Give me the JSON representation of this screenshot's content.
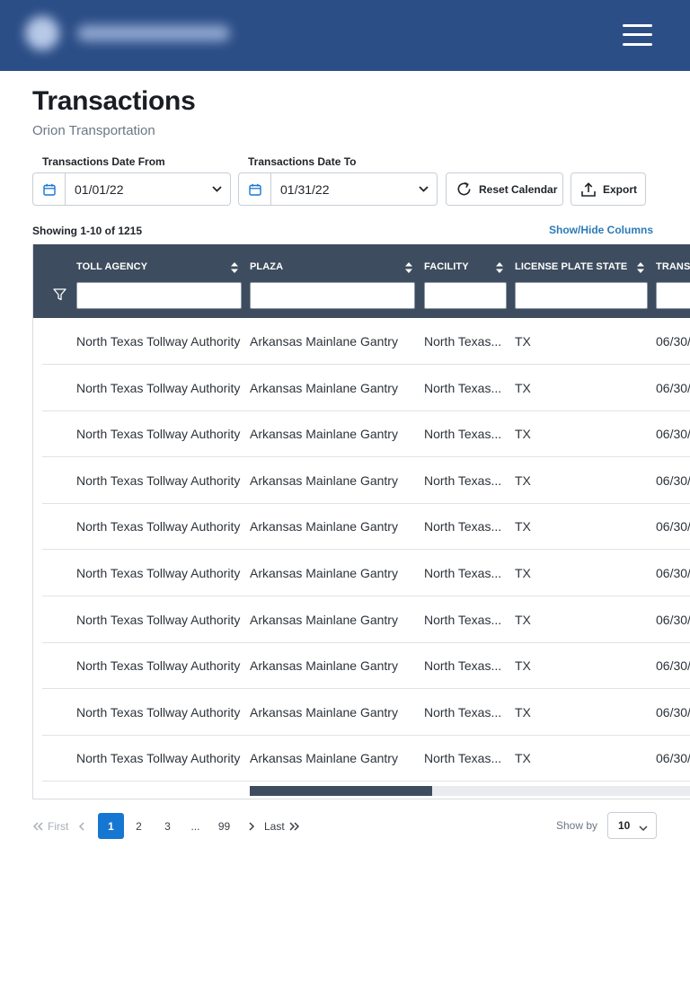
{
  "header": {
    "brand_logo_alt": "company logo (blurred)",
    "menu_icon": "hamburger-menu-icon",
    "background_color": "#2c4e87"
  },
  "page": {
    "title": "Transactions",
    "subtitle": "Orion Transportation"
  },
  "filters": {
    "date_from": {
      "label": "Transactions Date From",
      "value": "01/01/22",
      "icon": "calendar-icon"
    },
    "date_to": {
      "label": "Transactions Date To",
      "value": "01/31/22",
      "icon": "calendar-icon"
    },
    "reset_label": "Reset Calendar",
    "export_label": "Export"
  },
  "table_meta": {
    "showing": "Showing 1-10 of 1215",
    "show_hide_columns": "Show/Hide Columns"
  },
  "table": {
    "columns": [
      "TOLL AGENCY",
      "PLAZA",
      "FACILITY",
      "LICENSE PLATE STATE",
      "TRANSA"
    ],
    "rows": [
      [
        "North Texas Tollway Authority",
        "Arkansas Mainlane Gantry",
        "North Texas...",
        "TX",
        "06/30/"
      ],
      [
        "North Texas Tollway Authority",
        "Arkansas Mainlane Gantry",
        "North Texas...",
        "TX",
        "06/30/"
      ],
      [
        "North Texas Tollway Authority",
        "Arkansas Mainlane Gantry",
        "North Texas...",
        "TX",
        "06/30/"
      ],
      [
        "North Texas Tollway Authority",
        "Arkansas Mainlane Gantry",
        "North Texas...",
        "TX",
        "06/30/"
      ],
      [
        "North Texas Tollway Authority",
        "Arkansas Mainlane Gantry",
        "North Texas...",
        "TX",
        "06/30/"
      ],
      [
        "North Texas Tollway Authority",
        "Arkansas Mainlane Gantry",
        "North Texas...",
        "TX",
        "06/30/"
      ],
      [
        "North Texas Tollway Authority",
        "Arkansas Mainlane Gantry",
        "North Texas...",
        "TX",
        "06/30/"
      ],
      [
        "North Texas Tollway Authority",
        "Arkansas Mainlane Gantry",
        "North Texas...",
        "TX",
        "06/30/"
      ],
      [
        "North Texas Tollway Authority",
        "Arkansas Mainlane Gantry",
        "North Texas...",
        "TX",
        "06/30/"
      ],
      [
        "North Texas Tollway Authority",
        "Arkansas Mainlane Gantry",
        "North Texas...",
        "TX",
        "06/30/"
      ]
    ],
    "header_color": "#3d4c5e"
  },
  "pagination": {
    "first": "First",
    "last": "Last",
    "pages": [
      "1",
      "2",
      "3",
      "...",
      "99"
    ],
    "current": "1",
    "show_by_label": "Show by",
    "show_by_value": "10",
    "active_color": "#1677d2"
  },
  "colors": {
    "link": "#2b7bb9",
    "subtitle": "#6b7785"
  }
}
